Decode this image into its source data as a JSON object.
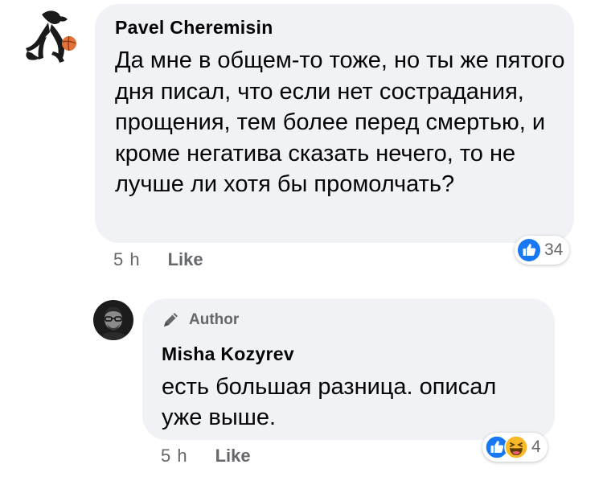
{
  "comments": [
    {
      "author": "Pavel  Cheremisin",
      "text": "Да мне в общем-то тоже, но ты же пятого дня писал, что если нет сострадания, прощения, тем более перед смертью, и кроме негатива сказать нечего, то не лучше ли хотя бы промолчать?",
      "time": "5 h",
      "like_label": "Like",
      "reaction_count": "34",
      "reactions": [
        "like-icon"
      ]
    },
    {
      "badge": "Author",
      "badge_icon": "pen-icon",
      "author": "Misha Kozyrev",
      "text": "есть большая разница. описал уже выше.",
      "time": "5 h",
      "like_label": "Like",
      "reaction_count": "4",
      "reactions": [
        "like-icon",
        "haha-icon"
      ]
    }
  ],
  "colors": {
    "bubble": "#f0f2f5",
    "like_blue": "#1877f2",
    "meta_gray": "#65676b",
    "text": "#050505"
  }
}
